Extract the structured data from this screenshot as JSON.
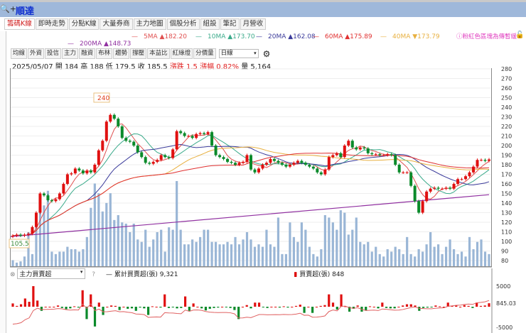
{
  "window": {
    "zoom_label": "🔍+",
    "title": "順達"
  },
  "tabs": [
    {
      "label": "籌碼K線",
      "active": true
    },
    {
      "label": "即時走勢"
    },
    {
      "label": "分點K線"
    },
    {
      "label": "大量券商"
    },
    {
      "label": "主力地圖"
    },
    {
      "label": "個股分析"
    },
    {
      "label": "組設"
    },
    {
      "label": "筆記"
    },
    {
      "label": "月營收"
    }
  ],
  "ma_legend": [
    {
      "label": "5MA",
      "arrow": "▲",
      "value": "182.20",
      "color": "#e05050"
    },
    {
      "label": "10MA",
      "arrow": "▲",
      "value": "173.70",
      "color": "#3aaa8a"
    },
    {
      "label": "20MA",
      "arrow": "▲",
      "value": "162.08",
      "color": "#3a3a9a"
    },
    {
      "label": "60MA",
      "arrow": "▲",
      "value": "175.89",
      "color": "#e03030"
    },
    {
      "label": "40MA",
      "arrow": "▼",
      "value": "173.79",
      "color": "#e8b040"
    },
    {
      "label": "200MA",
      "arrow": "▲",
      "value": "148.73",
      "color": "#9030a0"
    }
  ],
  "notice": "ⓘ粉紅色區塊為傳暫緩",
  "toolbar": {
    "buttons": [
      "均線",
      "外資",
      "投信",
      "主力",
      "融資",
      "布林",
      "趨勢",
      "撐壓",
      "本益比",
      "紅綠燈",
      "分價量"
    ],
    "period": "日線"
  },
  "info": {
    "date": "2025/05/07",
    "open_label": "開",
    "open": "184",
    "high_label": "高",
    "high": "188",
    "low_label": "低",
    "low": "179.5",
    "close_label": "收",
    "close": "185.5",
    "change_label": "漲跌",
    "change": "1.5",
    "pct_label": "漲幅",
    "pct": "0.82%",
    "vol_label": "量",
    "vol": "5,164"
  },
  "chart_data": {
    "type": "candlestick",
    "y_ticks": [
      280,
      270,
      260,
      250,
      240,
      230,
      220,
      210,
      200,
      190,
      180,
      170,
      160,
      150,
      140,
      130,
      120,
      110,
      100,
      90,
      80
    ],
    "high_label": "240",
    "low_label": "105.5",
    "closes": [
      106,
      107,
      106,
      107,
      108,
      115,
      130,
      150,
      148,
      143,
      142,
      144,
      150,
      160,
      170,
      171,
      176,
      174,
      171,
      174,
      172,
      180,
      195,
      205,
      225,
      232,
      228,
      220,
      208,
      205,
      204,
      200,
      193,
      188,
      182,
      181,
      183,
      185,
      190,
      188,
      187,
      196,
      215,
      213,
      210,
      210,
      208,
      212,
      213,
      212,
      214,
      200,
      190,
      188,
      186,
      183,
      182,
      180,
      182,
      183,
      190,
      175,
      172,
      176,
      180,
      182,
      186,
      184,
      182,
      180,
      178,
      180,
      182,
      184,
      182,
      180,
      178,
      176,
      172,
      170,
      175,
      188,
      190,
      192,
      188,
      200,
      205,
      198,
      196,
      198,
      197,
      192,
      191,
      191,
      190,
      190,
      191,
      190,
      180,
      172,
      172,
      172,
      158,
      142,
      130,
      142,
      152,
      155,
      156,
      155,
      155,
      156,
      155,
      160,
      165,
      165,
      168,
      172,
      178,
      185,
      185,
      184,
      185.5
    ],
    "volumes": [
      5,
      3,
      4,
      8,
      28,
      10,
      40,
      55,
      50,
      62,
      12,
      10,
      12,
      12,
      16,
      14,
      14,
      12,
      14,
      24,
      48,
      68,
      60,
      45,
      52,
      60,
      38,
      42,
      36,
      35,
      28,
      35,
      22,
      20,
      30,
      16,
      22,
      28,
      30,
      12,
      32,
      30,
      70,
      30,
      18,
      18,
      22,
      20,
      24,
      30,
      30,
      20,
      20,
      18,
      18,
      20,
      18,
      24,
      18,
      22,
      28,
      22,
      16,
      18,
      16,
      30,
      18,
      16,
      40,
      10,
      10,
      36,
      24,
      20,
      36,
      30,
      16,
      10,
      8,
      14,
      42,
      40,
      36,
      30,
      46,
      44,
      26,
      30,
      40,
      20,
      18,
      20,
      12,
      16,
      10,
      8,
      14,
      12,
      16,
      14,
      10,
      24,
      10,
      8,
      14,
      12,
      18,
      28,
      16,
      18,
      10,
      16,
      22,
      14,
      10,
      12,
      8,
      24,
      14,
      20,
      22,
      12,
      10
    ],
    "ma200": {
      "start": 105,
      "end": 148.73
    }
  },
  "lower_panel": {
    "indicator": "主力買賣超",
    "help": "?",
    "cum_label": "累計買賣超(張)",
    "cum_value": "9,321",
    "bar_label": "買賣超(張)",
    "bar_value": "848",
    "y_ticks": [
      "5000",
      "845.03",
      "-5000"
    ],
    "values": [
      800,
      200,
      600,
      2000,
      1200,
      5000,
      1500,
      -1000,
      0,
      0,
      0,
      300,
      -300,
      -600,
      -400,
      100,
      -200,
      4000,
      -3000,
      3000,
      -4800,
      1000,
      -2000,
      0,
      300,
      200,
      -800,
      0,
      -500,
      -400,
      -1000,
      -200,
      -400,
      -2000,
      100,
      0,
      -200,
      3000,
      -300,
      -100,
      -400,
      -300,
      2500,
      -1000,
      800,
      0,
      -400,
      -900,
      -500,
      -300,
      -200,
      0,
      -100,
      -300,
      -800,
      -3000,
      0,
      400,
      -400,
      1000,
      1000,
      -100,
      -300,
      0,
      0,
      -200,
      100,
      -200,
      0,
      200,
      500,
      -1500,
      0,
      -1500,
      0,
      200,
      400,
      3000,
      1000,
      -700,
      3000,
      100,
      -1200,
      -500,
      300,
      -1200,
      -900,
      100,
      0,
      -400,
      1000,
      -300,
      -400,
      -400,
      0,
      300,
      600,
      600,
      300,
      -1000,
      -300,
      -200,
      -100,
      300,
      100,
      0,
      1000,
      200,
      300,
      0,
      400,
      200,
      -300,
      1000,
      200,
      300,
      848
    ],
    "cum_end": 845.03
  }
}
